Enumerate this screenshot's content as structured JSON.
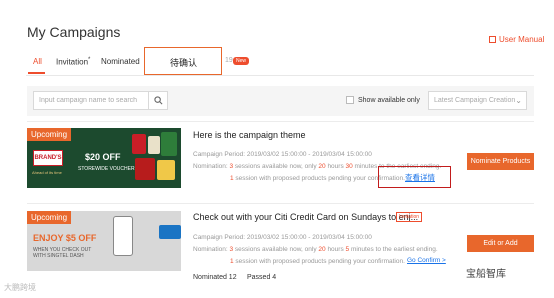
{
  "header": {
    "title": "My Campaigns",
    "user_manual": "User Manual"
  },
  "tabs": {
    "all": "All",
    "invitation": "Invitation",
    "invitation_mark": "*",
    "nominated": "Nominated",
    "pending": "待确认",
    "count_fragment": "19",
    "new_badge": "New"
  },
  "filters": {
    "search_placeholder": "Input campaign name to search",
    "show_available_label": "Show available only",
    "sort_value": "Latest Campaign Creation"
  },
  "campaigns": [
    {
      "status": "Upcoming",
      "title": "Here is the campaign theme",
      "period": "Campaign Period: 2019/03/02 15:00:00 - 2019/03/04 15:00:00",
      "nom_prefix": "Nomination: ",
      "sessions": "3",
      "sess_mid": " sessions available now, only ",
      "hours": "20",
      "hours_mid": " hours ",
      "minutes": "30",
      "minutes_suffix": " minutes to the earliest ending.",
      "pending_count": "1",
      "pending_text": " session with proposed products pending your confirmation.",
      "link": "查看详情",
      "button": "Nominate Products",
      "banner": {
        "logo": "BRAND'S",
        "tag": "Ahead of its time",
        "headline": "$20 OFF",
        "subline": "STOREWIDE VOUCHER"
      }
    },
    {
      "status": "Upcoming",
      "title": "Check out with your Citi Credit Card on Sundays to enj...",
      "tag": "Invitation",
      "period": "Campaign Period: 2019/03/02 15:00:00 - 2019/03/04 15:00:00",
      "nom_prefix": "Nomination: ",
      "sessions": "3",
      "sess_mid": " sessions available now, only ",
      "hours": "20",
      "hours_mid": " hours ",
      "minutes": "5",
      "minutes_suffix": " minutes to the earliest ending.",
      "pending_count": "1",
      "pending_text": " session with proposed products pending your confirmation.",
      "link": "Go Confirm >",
      "button": "Edit or Add",
      "nominated": "Nominated 12",
      "passed": "Passed 4",
      "banner": {
        "headline": "ENJOY $5 OFF",
        "subline1": "WHEN YOU CHECK OUT",
        "subline2": "WITH SINGTEL DASH"
      }
    }
  ],
  "watermarks": {
    "left": "大鹏跨境",
    "right": "宝船智库"
  },
  "colors": {
    "accent": "#ee4d2d",
    "button": "#e8672c",
    "link": "#1a73e8"
  }
}
